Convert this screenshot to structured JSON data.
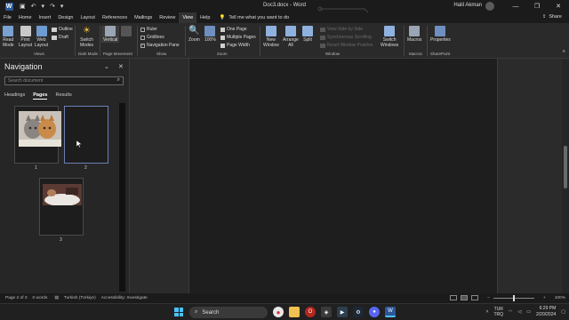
{
  "window": {
    "doc_title": "Doc3.docx",
    "app_name": "Word",
    "title_separator": " - ",
    "user_name": "Halil Akman",
    "min": "—",
    "restore": "❐",
    "close": "✕",
    "undo": "↶",
    "redo": "↷"
  },
  "menu": {
    "tabs": [
      "File",
      "Home",
      "Insert",
      "Design",
      "Layout",
      "References",
      "Mailings",
      "Review",
      "View",
      "Help"
    ],
    "active": "View",
    "tell_me": "Tell me what you want to do",
    "share": "Share"
  },
  "ribbon": {
    "views": {
      "read_mode": "Read\nMode",
      "print_layout": "Print\nLayout",
      "web_layout": "Web\nLayout",
      "outline": "Outline",
      "draft": "Draft",
      "label": "Views"
    },
    "dark_mode": {
      "switch_modes": "Switch\nModes",
      "label": "Dark Mode"
    },
    "page_movement": {
      "vertical": "Vertical",
      "label": "Page Movement"
    },
    "show": {
      "ruler": "Ruler",
      "gridlines": "Gridlines",
      "navigation_pane": "Navigation Pane",
      "navigation_checked": true,
      "label": "Show"
    },
    "zoom": {
      "zoom": "Zoom",
      "hundred": "100%",
      "one_page": "One Page",
      "multiple_pages": "Multiple Pages",
      "page_width": "Page Width",
      "label": "Zoom"
    },
    "window": {
      "new_window": "New\nWindow",
      "arrange_all": "Arrange\nAll",
      "split": "Split",
      "view_side_by_side": "View Side by Side",
      "sync_scrolling": "Synchronous Scrolling",
      "reset_position": "Reset Window Position",
      "switch_windows": "Switch\nWindows",
      "label": "Window"
    },
    "macros": {
      "macros": "Macros",
      "label": "Macros"
    },
    "sharepoint": {
      "properties": "Properties",
      "label": "SharePoint"
    }
  },
  "navigation": {
    "title": "Navigation",
    "search_placeholder": "Search document",
    "tabs": [
      "Headings",
      "Pages",
      "Results"
    ],
    "active_tab": "Pages",
    "pages": [
      {
        "number": "1",
        "content": "kittens"
      },
      {
        "number": "2",
        "content": "blank"
      },
      {
        "number": "3",
        "content": "photo"
      }
    ],
    "selected_page": "2"
  },
  "status": {
    "page": "Page 2 of 3",
    "words": "0 words",
    "language": "Turkish (Türkiye)",
    "accessibility": "Accessibility: Investigate",
    "zoom": "100%"
  },
  "taskbar": {
    "search": "Search",
    "lang_top": "TUR",
    "lang_bottom": "TRQ",
    "time": "6:29 PM",
    "date": "2/20/2024"
  },
  "colors": {
    "accent": "#2b5797",
    "windows_blue": "#4cc2ff"
  }
}
